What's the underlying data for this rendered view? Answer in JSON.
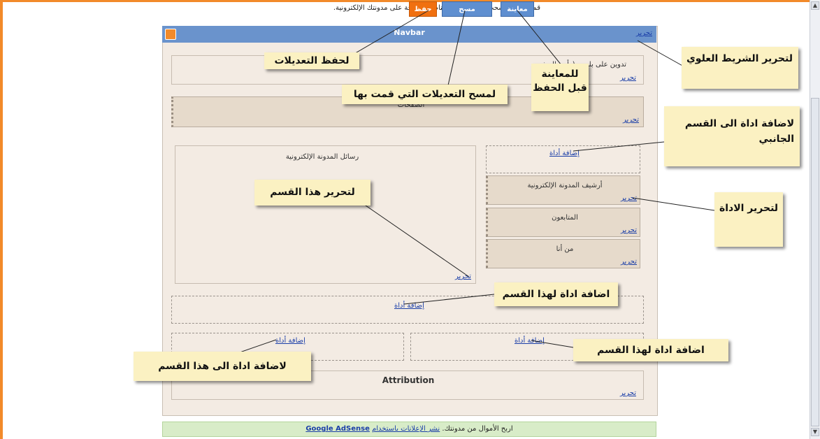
{
  "page": {
    "instruction": "قم بالنقر والسحب لإعادة ترتيب عناصر الصفحة على مدونتك الإلكترونية."
  },
  "toolbar": {
    "save_label": "حفظ",
    "clear_label": "مسح التعديلات",
    "preview_label": "معاينة"
  },
  "navbar": {
    "title": "Navbar",
    "edit_label": "تحرير"
  },
  "header_section": {
    "title": "تدوين على بلوجر (رأس الصفـ",
    "edit_label": "تحرير"
  },
  "pages_section": {
    "title": "الصفحات",
    "edit_label": "تحرير"
  },
  "main": {
    "title": "رسائل المدونة الإلكترونية",
    "edit_label": "تحرير"
  },
  "sidebar": {
    "add_gadget_label": "إضافة أداة",
    "widgets": [
      {
        "title": "أرشيف المدونة الإلكترونية",
        "edit_label": "تحرير"
      },
      {
        "title": "المتابعون",
        "edit_label": "تحرير"
      },
      {
        "title": "من أنا",
        "edit_label": "تحرير"
      }
    ]
  },
  "full_width": {
    "add_gadget_label": "إضافة أداة"
  },
  "footer_columns": {
    "left_add_label": "إضافة أداة",
    "right_add_label": "إضافة أداة"
  },
  "attribution": {
    "title": "Attribution",
    "edit_label": "تحرير"
  },
  "adsense": {
    "prefix": "اربح الأموال من مدونتك.",
    "link": "نشر الإعلانات باستخدام",
    "brand": "Google AdSense"
  },
  "annotations": {
    "save": "لحفظ التعديلات",
    "clear": "لمسح التعديلات التي قمت بها",
    "preview": "للمعاينة قبل الحفظ",
    "navbar_edit": "لتحرير الشريط العلوي",
    "add_sidebar": "لاضافة اداة الى القسم الجانبي",
    "edit_section": "لتحرير هذا القسم",
    "edit_gadget": "لتحرير الاداة",
    "add_to_section": "اضافة اداة لهذا القسم",
    "add_to_this_section": "اضافة اداة لهذا القسم",
    "add_to_left": "لاضافة اداة الى هذا القسم"
  }
}
